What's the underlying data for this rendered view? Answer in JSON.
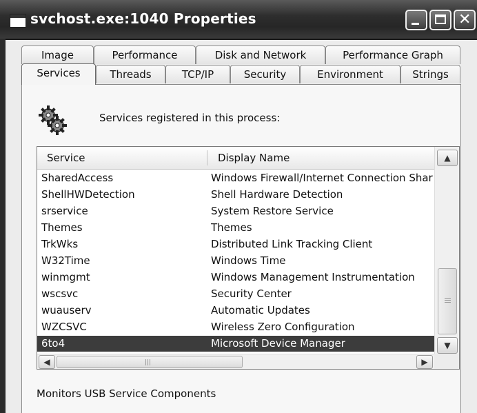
{
  "window": {
    "title": "svchost.exe:1040 Properties",
    "controls": {
      "minimize_icon": "minimize-icon",
      "maximize_icon": "maximize-icon",
      "close_icon": "close-icon"
    }
  },
  "tabs": {
    "row_back": [
      "Image",
      "Performance",
      "Disk and Network",
      "Performance Graph"
    ],
    "row_front": [
      "Services",
      "Threads",
      "TCP/IP",
      "Security",
      "Environment",
      "Strings"
    ],
    "active": "Services"
  },
  "services_panel": {
    "caption": "Services registered in this process:",
    "icon": "gears-icon",
    "columns": [
      "Service",
      "Display Name"
    ],
    "rows": [
      {
        "service": "SharedAccess",
        "display_name": "Windows Firewall/Internet Connection Shar"
      },
      {
        "service": "ShellHWDetection",
        "display_name": "Shell Hardware Detection"
      },
      {
        "service": "srservice",
        "display_name": "System Restore Service"
      },
      {
        "service": "Themes",
        "display_name": "Themes"
      },
      {
        "service": "TrkWks",
        "display_name": "Distributed Link Tracking Client"
      },
      {
        "service": "W32Time",
        "display_name": "Windows Time"
      },
      {
        "service": "winmgmt",
        "display_name": "Windows Management Instrumentation"
      },
      {
        "service": "wscsvc",
        "display_name": "Security Center"
      },
      {
        "service": "wuauserv",
        "display_name": "Automatic Updates"
      },
      {
        "service": "WZCSVC",
        "display_name": "Wireless Zero Configuration"
      },
      {
        "service": "6to4",
        "display_name": "Microsoft Device Manager",
        "selected": true
      }
    ],
    "description": "Monitors USB Service Components"
  },
  "colors": {
    "titlebar": "#2e2e2e",
    "selection_bg": "#3c3c3c",
    "selection_fg": "#ffffff"
  }
}
